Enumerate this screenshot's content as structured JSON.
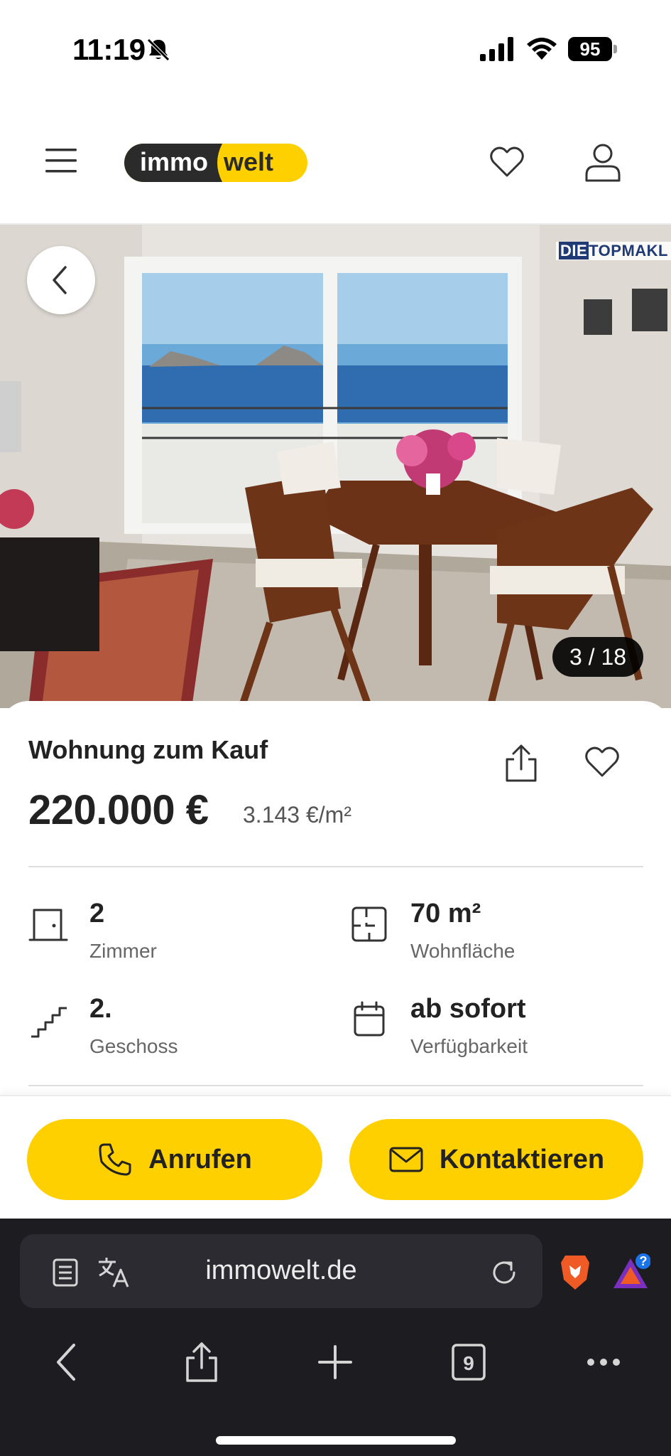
{
  "status_bar": {
    "time": "11:19",
    "battery": "95"
  },
  "header": {
    "logo_immo": "immo",
    "logo_welt": "welt"
  },
  "gallery": {
    "counter": "3 / 18",
    "watermark_a": "DIE",
    "watermark_b": "TOPMAKL"
  },
  "listing": {
    "type": "Wohnung zum Kauf",
    "price": "220.000 €",
    "price_per_sqm": "3.143 €/m²",
    "features": [
      {
        "value": "2",
        "label": "Zimmer",
        "icon": "door-icon"
      },
      {
        "value": "70 m²",
        "label": "Wohnfläche",
        "icon": "floorplan-icon"
      },
      {
        "value": "2.",
        "label": "Geschoss",
        "icon": "stairs-icon"
      },
      {
        "value": "ab sofort",
        "label": "Verfügbarkeit",
        "icon": "calendar-icon"
      }
    ]
  },
  "actions": {
    "call_label": "Anrufen",
    "contact_label": "Kontaktieren"
  },
  "browser": {
    "url": "immowelt.de",
    "tab_count": "9"
  },
  "colors": {
    "brand_yellow": "#fed000",
    "dark": "#222222",
    "browser_bg": "#1c1c21"
  }
}
